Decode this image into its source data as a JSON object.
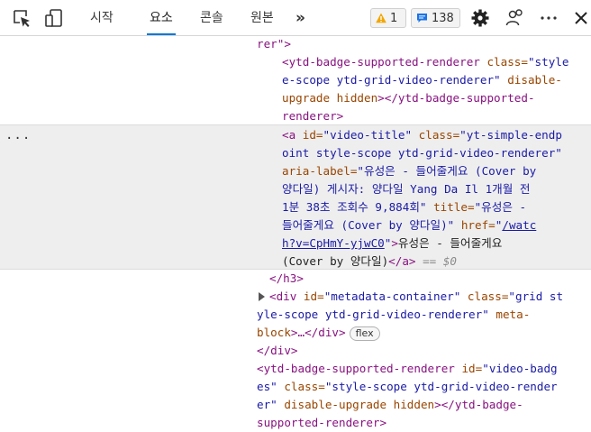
{
  "toolbar": {
    "tabs": [
      {
        "label": "시작"
      },
      {
        "label": "요소"
      },
      {
        "label": "콘솔"
      },
      {
        "label": "원본"
      }
    ],
    "active_tab": "요소",
    "warnings_count": "1",
    "issues_count": "138",
    "more_tabs_glyph": "»",
    "accent_color": "#0078d4"
  },
  "dom": {
    "l01": "rer\">",
    "l02_tag": "<ytd-badge-supported-renderer",
    "l02_an": " class=",
    "l02_av": "\"style",
    "l03_av": "e-scope ytd-grid-video-renderer\"",
    "l03_an": " disable-",
    "l04_an": "upgrade",
    "l04_an2": " hidden",
    "l04_tag": "></ytd-badge-supported-",
    "l05_tag": "renderer>",
    "l06_tag": "<a",
    "l06_an": " id=",
    "l06_av": "\"video-title\"",
    "l06_an2": " class=",
    "l06_av2": "\"yt-simple-endp",
    "l07_av": "oint style-scope ytd-grid-video-renderer\"",
    "l08_an": "aria-label=",
    "l08_av": "\"유성은 - 들어줄게요 (Cover by",
    "l09_av": "양다일) 게시자: 양다일 Yang Da Il 1개월 전",
    "l10_av": "1분 38초 조회수 9,884회\"",
    "l10_an": " title=",
    "l10_av2": "\"유성은 -",
    "l11_av": "들어줄게요 (Cover by 양다일)\"",
    "l11_an": " href=",
    "l11_q": "\"",
    "l11_link": "/watc",
    "l12_link": "h?v=CpHmY-yjwC0",
    "l12_q": "\"",
    "l12_tag": ">",
    "l12_txt": "유성은 - 들어줄게요",
    "l13_txt": "(Cover by 양다일)",
    "l13_tag": "</a>",
    "l13_sel": " == $0",
    "l14_tag": "</h3>",
    "l15_tag": "<div",
    "l15_an": " id=",
    "l15_av": "\"metadata-container\"",
    "l15_an2": " class=",
    "l15_av2": "\"grid st",
    "l16_av": "yle-scope ytd-grid-video-renderer\"",
    "l16_an": " meta-",
    "l17_an": "block",
    "l17_tag": ">…</div>",
    "l17_badge": "flex",
    "l18_tag": "</div>",
    "l19_tag": "<ytd-badge-supported-renderer",
    "l19_an": " id=",
    "l19_av": "\"video-badg",
    "l20_av": "es\"",
    "l20_an": " class=",
    "l20_av2": "\"style-scope ytd-grid-video-render",
    "l21_av": "er\"",
    "l21_an": " disable-upgrade hidden",
    "l21_tag": "></ytd-badge-",
    "l22_tag": "supported-renderer>"
  }
}
